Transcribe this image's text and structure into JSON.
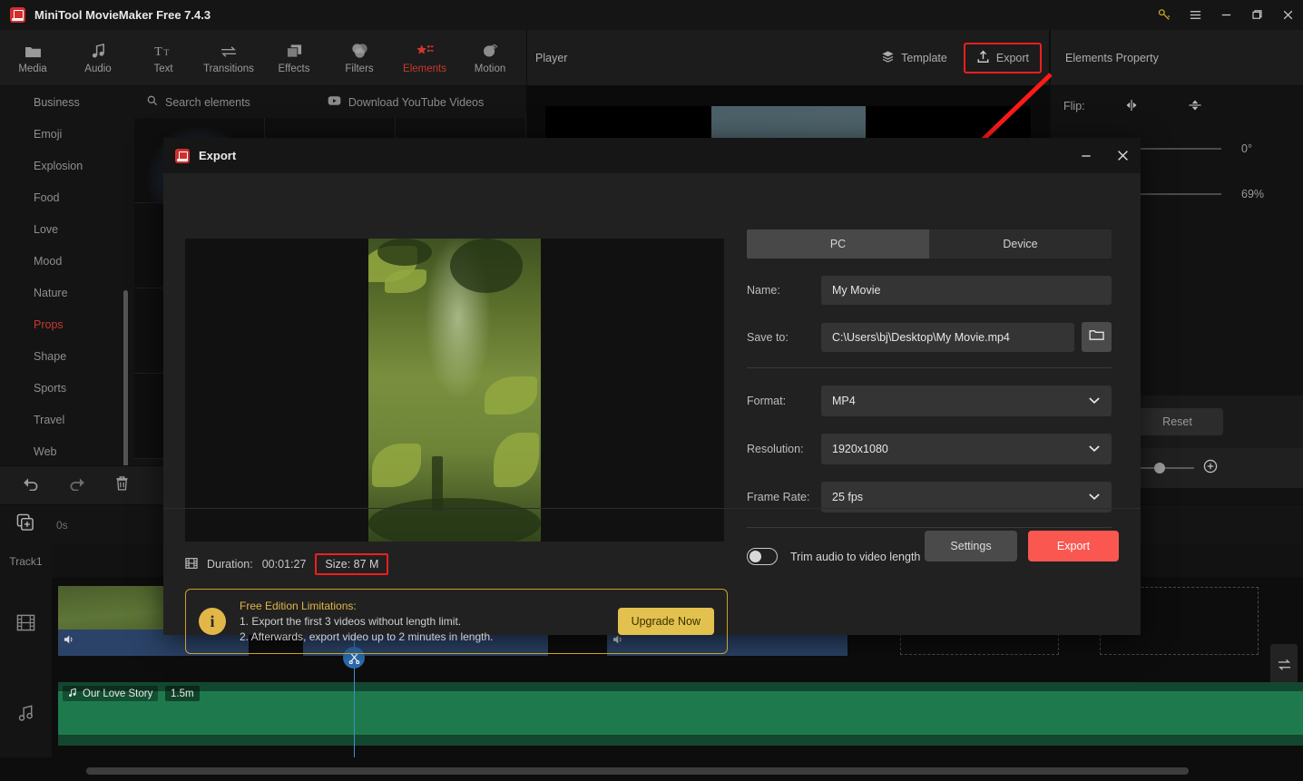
{
  "window": {
    "title": "MiniTool MovieMaker Free 7.4.3",
    "controls": [
      {
        "name": "key-icon",
        "label": "key"
      },
      {
        "name": "menu-icon",
        "label": "menu"
      },
      {
        "name": "minimize-icon",
        "label": "minimize"
      },
      {
        "name": "maximize-icon",
        "label": "maximize"
      },
      {
        "name": "close-icon",
        "label": "close"
      }
    ]
  },
  "toolbar": {
    "items": [
      {
        "label": "Media",
        "icon": "folder-icon",
        "active": false
      },
      {
        "label": "Audio",
        "icon": "music-note-icon",
        "active": false
      },
      {
        "label": "Text",
        "icon": "text-icon",
        "active": false
      },
      {
        "label": "Transitions",
        "icon": "transitions-icon",
        "active": false
      },
      {
        "label": "Effects",
        "icon": "effects-icon",
        "active": false
      },
      {
        "label": "Filters",
        "icon": "filters-icon",
        "active": false
      },
      {
        "label": "Elements",
        "icon": "elements-icon",
        "active": true
      },
      {
        "label": "Motion",
        "icon": "motion-icon",
        "active": false
      }
    ]
  },
  "elements_panel": {
    "categories": [
      {
        "label": "Business",
        "active": false
      },
      {
        "label": "Emoji",
        "active": false
      },
      {
        "label": "Explosion",
        "active": false
      },
      {
        "label": "Food",
        "active": false
      },
      {
        "label": "Love",
        "active": false
      },
      {
        "label": "Mood",
        "active": false
      },
      {
        "label": "Nature",
        "active": false
      },
      {
        "label": "Props",
        "active": true
      },
      {
        "label": "Shape",
        "active": false
      },
      {
        "label": "Sports",
        "active": false
      },
      {
        "label": "Travel",
        "active": false
      },
      {
        "label": "Web",
        "active": false
      }
    ],
    "search_placeholder": "Search elements",
    "download_label": "Download YouTube Videos"
  },
  "player": {
    "label": "Player",
    "template_label": "Template",
    "export_label": "Export"
  },
  "properties": {
    "title": "Elements Property",
    "flip_label": "Flip:",
    "rotation_value": "0°",
    "scale_value": "69%",
    "reset_label": "Reset"
  },
  "timeline": {
    "time_label": "0s",
    "track1_label": "Track1",
    "audio_clip_name": "Our Love Story",
    "audio_clip_length": "1.5m"
  },
  "dialog": {
    "title": "Export",
    "tabs": [
      {
        "label": "PC",
        "active": true
      },
      {
        "label": "Device",
        "active": false
      }
    ],
    "fields": {
      "name_label": "Name:",
      "name_value": "My Movie",
      "saveto_label": "Save to:",
      "saveto_value": "C:\\Users\\bj\\Desktop\\My Movie.mp4",
      "format_label": "Format:",
      "format_value": "MP4",
      "resolution_label": "Resolution:",
      "resolution_value": "1920x1080",
      "framerate_label": "Frame Rate:",
      "framerate_value": "25 fps"
    },
    "trim_label": "Trim audio to video length",
    "trim_enabled": false,
    "meta": {
      "duration_label": "Duration:",
      "duration_value": "00:01:27",
      "size_text": "Size: 87 M"
    },
    "limitations": {
      "title": "Free Edition Limitations:",
      "line1": "1. Export the first 3 videos without length limit.",
      "line2": "2. Afterwards, export video up to 2 minutes in length.",
      "upgrade_label": "Upgrade Now"
    },
    "buttons": {
      "settings_label": "Settings",
      "export_label": "Export"
    }
  },
  "colors": {
    "accent_red": "#c8382f",
    "export_button": "#fa5750",
    "highlight_box": "#ee1f1f",
    "warning_gold": "#e2b748",
    "upgrade_button": "#e2c14e"
  }
}
